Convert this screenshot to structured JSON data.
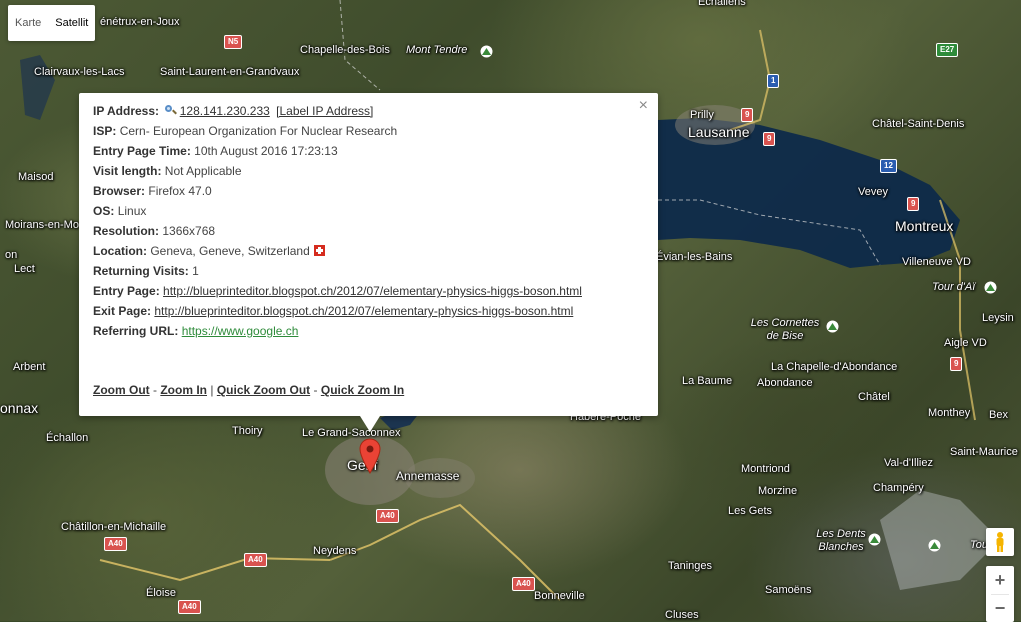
{
  "map_type": {
    "map": "Karte",
    "satellite": "Satellit"
  },
  "info": {
    "ip_label": "IP Address:",
    "ip_value": "128.141.230.233",
    "ip_tag_link": "[Label IP Address]",
    "isp_label": "ISP:",
    "isp_value": "Cern- European Organization For Nuclear Research",
    "entry_time_label": "Entry Page Time:",
    "entry_time_value": "10th August 2016 17:23:13",
    "visit_length_label": "Visit length:",
    "visit_length_value": "Not Applicable",
    "browser_label": "Browser:",
    "browser_value": "Firefox 47.0",
    "os_label": "OS:",
    "os_value": "Linux",
    "resolution_label": "Resolution:",
    "resolution_value": "1366x768",
    "location_label": "Location:",
    "location_value": "Geneva, Geneve, Switzerland",
    "returning_label": "Returning Visits:",
    "returning_value": "1",
    "entry_page_label": "Entry Page:",
    "entry_page_value": "http://blueprinteditor.blogspot.ch/2012/07/elementary-physics-higgs-boson.html",
    "exit_page_label": "Exit Page:",
    "exit_page_value": "http://blueprinteditor.blogspot.ch/2012/07/elementary-physics-higgs-boson.html",
    "referring_label": "Referring URL:",
    "referring_value": "https://www.google.ch",
    "zoom_out": "Zoom Out",
    "sep_dash": "-",
    "zoom_in": "Zoom In",
    "sep_bar": "|",
    "quick_zoom_out": "Quick Zoom Out",
    "quick_zoom_in": "Quick Zoom In",
    "close": "×"
  },
  "zoom": {
    "plus": "+",
    "minus": "−"
  },
  "places": {
    "enetrux": "énétrux-en-Joux",
    "chapelle": "Chapelle-des-Bois",
    "mont_tendre": "Mont Tendre",
    "echallens": "Échallens",
    "clairvaux": "Clairvaux-les-Lacs",
    "saint_laurent": "Saint-Laurent-en-Grandvaux",
    "prilly": "Prilly",
    "lausanne": "Lausanne",
    "chatel": "Châtel-Saint-Denis",
    "maisod": "Maisod",
    "vevey": "Vevey",
    "moirans": "Moirans-en-Mo",
    "montreux": "Montreux",
    "on": "on",
    "villeneuve": "Villeneuve VD",
    "evian": "Évian-les-Bains",
    "lect": "Lect",
    "tour_ai": "Tour d'Aï",
    "leysin": "Leysin",
    "cornettes": "Les Cornettes de Bise",
    "aigle": "Aigle VD",
    "arbent": "Arbent",
    "chapelle_ab": "La Chapelle-d'Abondance",
    "la_baume": "La Baume",
    "abondance": "Abondance",
    "onnax": "onnax",
    "chatel_fr": "Châtel",
    "habere": "Habère-Poche",
    "monthey": "Monthey",
    "bex": "Bex",
    "echallon": "Échallon",
    "thoiry": "Thoiry",
    "grand_saconnex": "Le Grand-Saconnex",
    "saint_maurice": "Saint-Maurice",
    "genf": "Genf",
    "annemasse": "Annemasse",
    "montriond": "Montriond",
    "val_illiez": "Val-d'Illiez",
    "morzine": "Morzine",
    "champery": "Champéry",
    "chatillon": "Châtillon-en-Michaille",
    "les_gets": "Les Gets",
    "dents_blanches": "Les Dents Blanches",
    "tour_sa": "Tour Sa",
    "neydens": "Neydens",
    "taninges": "Taninges",
    "eloise": "Éloise",
    "bonneville": "Bonneville",
    "samoens": "Samoëns",
    "cluses": "Cluses"
  },
  "roads": {
    "n5": "N5",
    "e27": "E27",
    "r1": "1",
    "r9a": "9",
    "r9b": "9",
    "r12": "12",
    "r9c": "9",
    "r9d": "9",
    "a40a": "A40",
    "a40b": "A40",
    "a40c": "A40",
    "a40d": "A40",
    "a40e": "A40"
  }
}
